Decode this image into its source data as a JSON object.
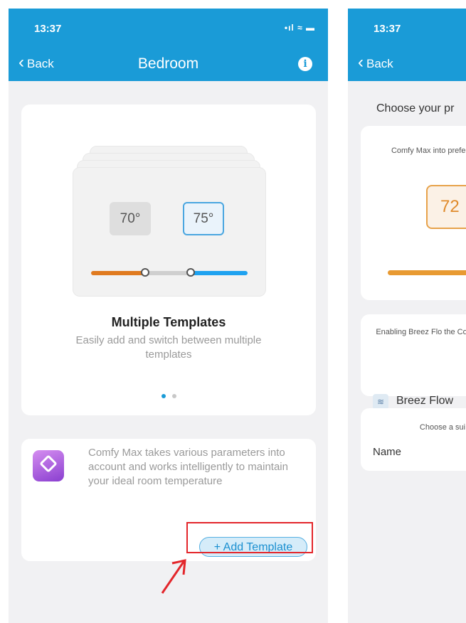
{
  "left_screen": {
    "status": {
      "time": "13:37",
      "icons": "•ıl ≈ ▬"
    },
    "nav": {
      "back_label": "Back",
      "title": "Bedroom",
      "info_icon": "info-icon"
    },
    "carousel": {
      "warm_temp": "70°",
      "cool_temp": "75°",
      "title": "Multiple Templates",
      "subtitle": "Easily add and switch between multiple templates",
      "page_count": 2,
      "active_page": 1
    },
    "info_card": {
      "text": "Comfy Max takes various parameters into account and works intelligently to maintain your ideal room temperature",
      "add_button_label": "+ Add Template"
    }
  },
  "right_screen": {
    "status": {
      "time": "13:37"
    },
    "nav": {
      "back_label": "Back"
    },
    "heading": "Choose your pr",
    "card1_text": "Comfy Max into preferred",
    "temp_value": "72",
    "card2_text": "Enabling Breez Flo the Cool S",
    "breez_label": "Breez Flow",
    "card3_text": "Choose a sui",
    "name_label": "Name"
  },
  "colors": {
    "accent": "#1a9bd7",
    "warm": "#e07a1f",
    "cool": "#1fa2f0",
    "highlight": "#e3262b"
  }
}
